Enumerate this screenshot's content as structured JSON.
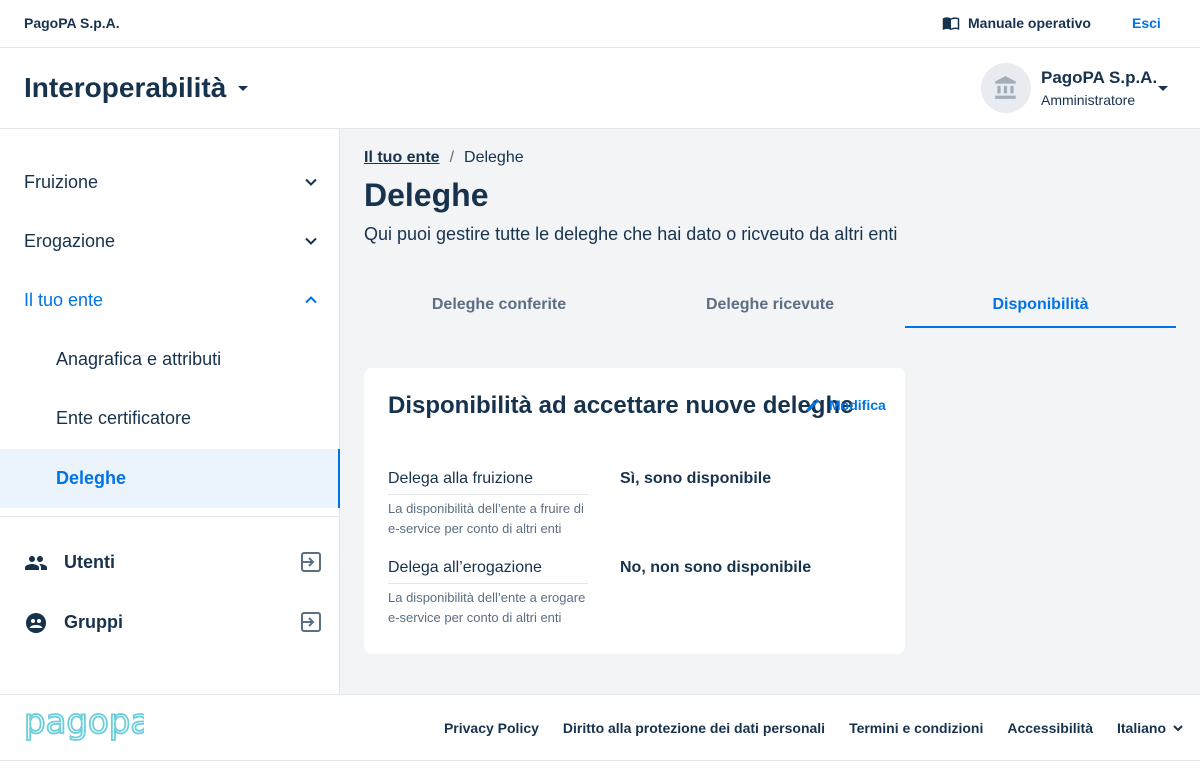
{
  "topbar": {
    "company": "PagoPA S.p.A.",
    "manual_label": "Manuale operativo",
    "logout_label": "Esci"
  },
  "product": {
    "name": "Interoperabilità"
  },
  "party": {
    "name": "PagoPA S.p.A.",
    "role": "Amministratore"
  },
  "sidebar": {
    "items": [
      {
        "label": "Fruizione"
      },
      {
        "label": "Erogazione"
      },
      {
        "label": "Il tuo ente"
      }
    ],
    "sub_items": [
      {
        "label": "Anagrafica e attributi"
      },
      {
        "label": "Ente certificatore"
      },
      {
        "label": "Deleghe"
      }
    ],
    "links": [
      {
        "label": "Utenti"
      },
      {
        "label": "Gruppi"
      }
    ]
  },
  "breadcrumb": {
    "parent": "Il tuo ente",
    "separator": "/",
    "current": "Deleghe"
  },
  "page": {
    "title": "Deleghe",
    "description": "Qui puoi gestire tutte le deleghe che hai dato o ricveuto da altri enti"
  },
  "tabs": [
    {
      "label": "Deleghe conferite"
    },
    {
      "label": "Deleghe ricevute"
    },
    {
      "label": "Disponibilità"
    }
  ],
  "card": {
    "title": "Disponibilità ad accettare nuove deleghe",
    "edit_label": "Modifica",
    "rows": [
      {
        "label": "Delega alla fruizione",
        "help": "La disponibilità dell’ente a fruire di e-service per conto di altri enti",
        "value": "Sì, sono disponibile"
      },
      {
        "label": "Delega all’erogazione",
        "help": "La disponibilità dell’ente a erogare e-service per conto di altri enti",
        "value": "No, non sono disponibile"
      }
    ]
  },
  "footer": {
    "logo_text": "pagopa",
    "links": [
      {
        "label": "Privacy Policy"
      },
      {
        "label": "Diritto alla protezione dei dati personali"
      },
      {
        "label": "Termini e condizioni"
      },
      {
        "label": "Accessibilità"
      }
    ],
    "language": "Italiano"
  },
  "colors": {
    "primary": "#0073e6",
    "text": "#17324d",
    "muted": "#5c6f82",
    "background": "#f2f4f6",
    "logo": "#6bcfdb"
  }
}
